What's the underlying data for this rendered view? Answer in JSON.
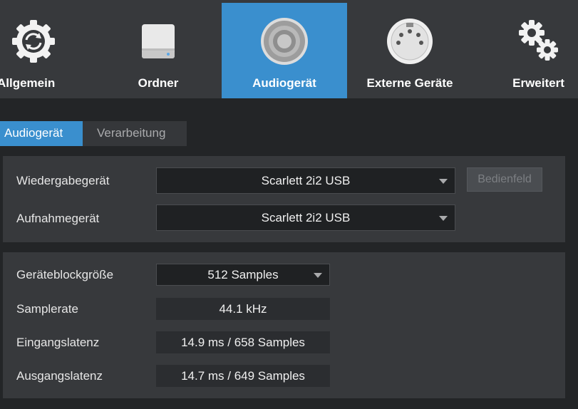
{
  "toolbar": {
    "items": [
      {
        "label": "Allgemein",
        "icon": "sync-gear-icon"
      },
      {
        "label": "Ordner",
        "icon": "drive-icon"
      },
      {
        "label": "Audiogerät",
        "icon": "speaker-icon"
      },
      {
        "label": "Externe Geräte",
        "icon": "midi-connector-icon"
      },
      {
        "label": "Erweitert",
        "icon": "gears-icon"
      }
    ],
    "active_index": 2
  },
  "tabs": [
    {
      "label": "Audiogerät",
      "active": true
    },
    {
      "label": "Verarbeitung",
      "active": false
    }
  ],
  "devices": {
    "playback_label": "Wiedergabegerät",
    "playback_value": "Scarlett 2i2 USB",
    "control_panel_label": "Bedienfeld",
    "record_label": "Aufnahmegerät",
    "record_value": "Scarlett 2i2 USB"
  },
  "settings": {
    "block_size_label": "Geräteblockgröße",
    "block_size_value": "512 Samples",
    "sample_rate_label": "Samplerate",
    "sample_rate_value": "44.1 kHz",
    "input_latency_label": "Eingangslatenz",
    "input_latency_value": "14.9 ms / 658 Samples",
    "output_latency_label": "Ausgangslatenz",
    "output_latency_value": "14.7 ms / 649 Samples"
  },
  "colors": {
    "accent": "#3a8fce",
    "background": "#232527",
    "panel": "#37393c"
  }
}
